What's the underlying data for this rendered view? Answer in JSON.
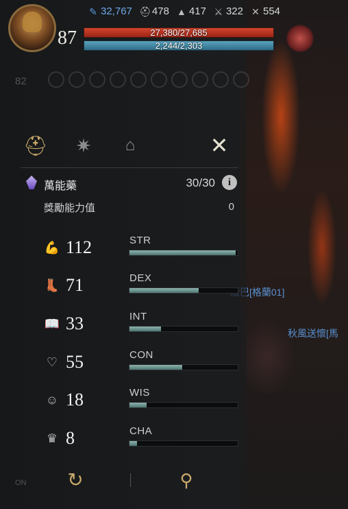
{
  "player": {
    "level": "87",
    "hp": "27,380/27,685",
    "mp": "2,244/2,303",
    "hp_fraction": 0.989,
    "mp_fraction": 0.974
  },
  "currencies": [
    {
      "icon": "feather-icon",
      "value": "32,767",
      "color": "#6fa8e8"
    },
    {
      "icon": "helmet-icon",
      "value": "478"
    },
    {
      "icon": "hat-icon",
      "value": "417"
    },
    {
      "icon": "sword-icon",
      "value": "322"
    },
    {
      "icon": "crossed-swords-icon",
      "value": "554"
    }
  ],
  "tabs": [
    {
      "icon": "helmet-icon",
      "active": true
    },
    {
      "icon": "star-icon",
      "active": false
    },
    {
      "icon": "house-icon",
      "active": false
    },
    {
      "icon": "crossed-swords-icon",
      "active": false
    }
  ],
  "elixir": {
    "label": "萬能藥",
    "count": "30/30",
    "info": "i"
  },
  "reward": {
    "label": "獎勵能力值",
    "value": "0"
  },
  "stats": [
    {
      "icon": "arm-icon",
      "value": "112",
      "name": "STR",
      "fill": 0.98
    },
    {
      "icon": "boot-icon",
      "value": "71",
      "name": "DEX",
      "fill": 0.64
    },
    {
      "icon": "book-icon",
      "value": "33",
      "name": "INT",
      "fill": 0.29
    },
    {
      "icon": "heart-icon",
      "value": "55",
      "name": "CON",
      "fill": 0.49
    },
    {
      "icon": "head-icon",
      "value": "18",
      "name": "WIS",
      "fill": 0.16
    },
    {
      "icon": "crown-icon",
      "value": "8",
      "name": "CHA",
      "fill": 0.07
    }
  ],
  "background": {
    "ghost_level": "82",
    "ghost_on": "ON",
    "name1": "蔽巴[格蘭01]",
    "name2": "秋風送懷[馬"
  }
}
